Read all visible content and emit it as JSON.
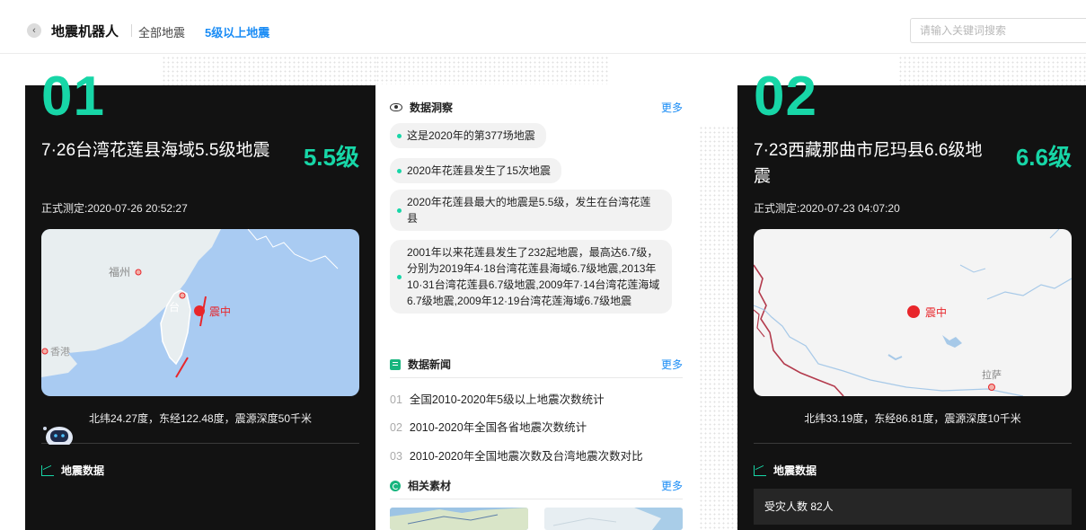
{
  "header": {
    "title": "地震机器人",
    "nav": [
      "全部地震",
      "5级以上地震"
    ],
    "search_placeholder": "请输入关键词搜索"
  },
  "cards": [
    {
      "num": "01",
      "title": "7·26台湾花莲县海域5.5级地震",
      "magnitude": "5.5级",
      "time": "正式测定:2020-07-26 20:52:27",
      "map_labels": {
        "city1": "福州",
        "city2": "台",
        "marker": "震中",
        "city3": "香港"
      },
      "coords": "北纬24.27度，东经122.48度，震源深度50千米",
      "section": "地震数据"
    },
    {
      "num": "02",
      "title": "7·23西藏那曲市尼玛县6.6级地震",
      "magnitude": "6.6级",
      "time": "正式测定:2020-07-23 04:07:20",
      "map_labels": {
        "marker": "震中",
        "city1": "拉萨"
      },
      "coords": "北纬33.19度，东经86.81度，震源深度10千米",
      "section": "地震数据",
      "affected": "受灾人数 82人"
    }
  ],
  "insights": {
    "label": "数据洞察",
    "more": "更多",
    "items": [
      "这是2020年的第377场地震",
      "2020年花莲县发生了15次地震",
      "2020年花莲县最大的地震是5.5级，发生在台湾花莲县",
      "2001年以来花莲县发生了232起地震，最高达6.7级，分别为2019年4·18台湾花莲县海域6.7级地震,2013年10·31台湾花莲县6.7级地震,2009年7·14台湾花莲海域6.7级地震,2009年12·19台湾花莲海域6.7级地震"
    ]
  },
  "news": {
    "label": "数据新闻",
    "more": "更多",
    "items": [
      {
        "num": "01",
        "text": "全国2010-2020年5级以上地震次数统计"
      },
      {
        "num": "02",
        "text": "2010-2020年全国各省地震次数统计"
      },
      {
        "num": "03",
        "text": "2010-2020年全国地震次数及台湾地震次数对比"
      }
    ]
  },
  "materials": {
    "label": "相关素材",
    "more": "更多"
  },
  "colors": {
    "accent": "#17d6a7",
    "link": "#1a8cf5",
    "card_bg": "#121212",
    "marker": "#e8262b"
  }
}
